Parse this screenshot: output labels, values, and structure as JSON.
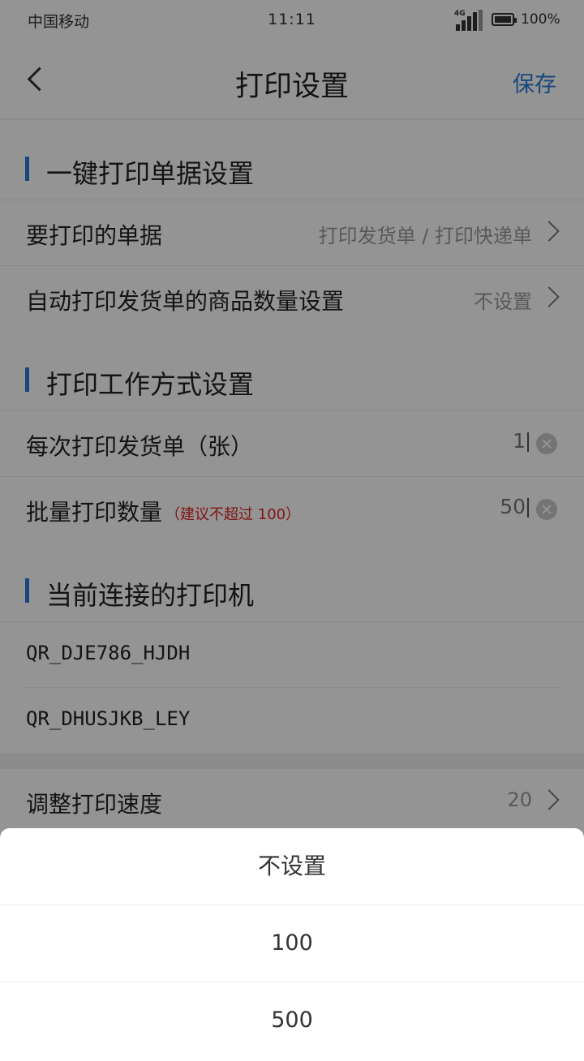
{
  "status_bar": {
    "carrier": "中国移动",
    "time": "11:11",
    "signal_label": "4G",
    "battery": "100%"
  },
  "nav": {
    "title": "打印设置",
    "save_label": "保存"
  },
  "section_one_key": {
    "title": "一键打印单据设置",
    "rows": [
      {
        "label": "要打印的单据",
        "value": "打印发货单 / 打印快递单"
      },
      {
        "label": "自动打印发货单的商品数量设置",
        "value": "不设置"
      }
    ]
  },
  "section_work_mode": {
    "title": "打印工作方式设置",
    "copies": {
      "label": "每次打印发货单（张）",
      "value": "1"
    },
    "batch": {
      "label": "批量打印数量",
      "hint": "（建议不超过 100）",
      "value": "50"
    }
  },
  "section_printer": {
    "title": "当前连接的打印机",
    "printers": [
      "QR_DJE786_HJDH",
      "QR_DHUSJKB_LEY"
    ]
  },
  "speed": {
    "label": "调整打印速度",
    "value": "20"
  },
  "picker": {
    "options": [
      "不设置",
      "100",
      "500"
    ]
  },
  "colors": {
    "accent": "#2a7bd6",
    "hint": "#e02424"
  }
}
